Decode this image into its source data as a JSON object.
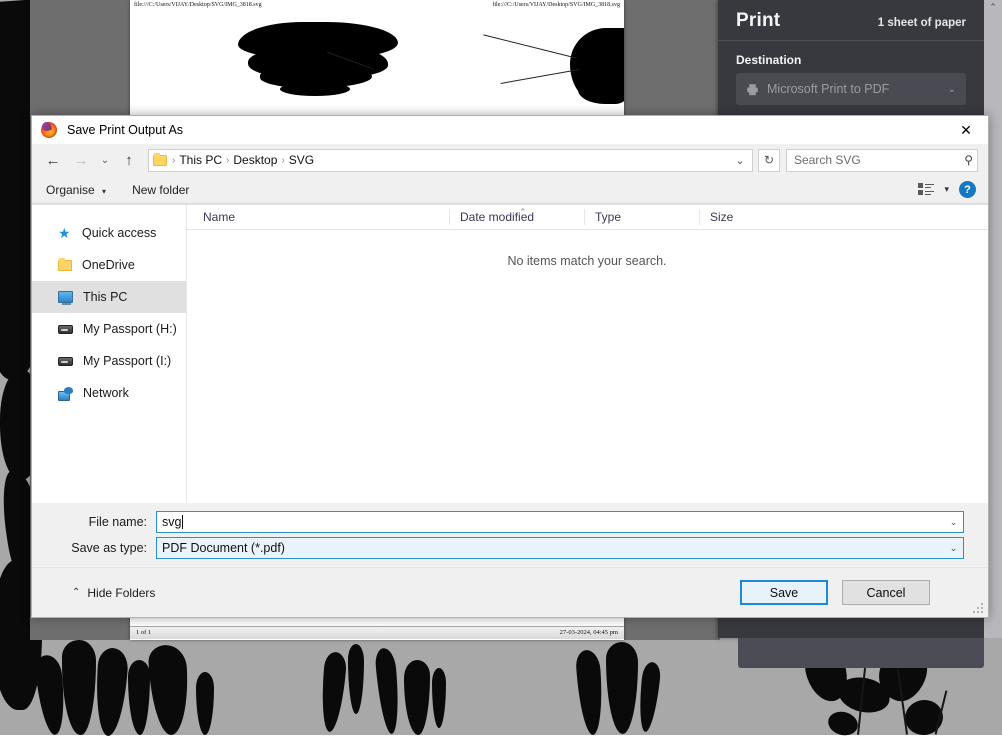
{
  "print_panel": {
    "title": "Print",
    "sheets": "1 sheet of paper",
    "destination_label": "Destination",
    "destination_value": "Microsoft Print to PDF",
    "printer_icon": "printer-icon",
    "chevron_icon": "chevron-down-icon",
    "accent_color": "#1c8098",
    "background_color": "#38393f"
  },
  "preview": {
    "header_left": "file:///C:/Users/VIJAY/Desktop/SVG/IMG_3818.svg",
    "header_right": "file:///C:/Users/VIJAY/Desktop/SVG/IMG_3818.svg",
    "footer_left": "1 of 1",
    "footer_right": "27-03-2024, 04:45 pm"
  },
  "dialog": {
    "title": "Save Print Output As",
    "app_icon": "firefox-icon",
    "close_icon": "close-icon",
    "nav": {
      "back_icon": "arrow-left-icon",
      "forward_icon": "arrow-right-icon",
      "recent_icon": "chevron-down-icon",
      "up_icon": "arrow-up-icon",
      "folder_icon": "folder-icon",
      "breadcrumbs": [
        "This PC",
        "Desktop",
        "SVG"
      ],
      "separator": "›",
      "address_dropdown_icon": "chevron-down-icon",
      "refresh_icon": "refresh-icon"
    },
    "search": {
      "placeholder": "Search SVG",
      "value": "",
      "icon": "search-icon"
    },
    "command_bar": {
      "organise": "Organise",
      "organise_caret": "▾",
      "new_folder": "New folder",
      "view_icon": "view-layout-icon",
      "view_caret": "▾",
      "help_label": "?",
      "help_icon": "help-icon"
    },
    "sidebar": {
      "items": [
        {
          "label": "Quick access",
          "icon": "star-icon",
          "selected": false
        },
        {
          "label": "OneDrive",
          "icon": "folder-icon",
          "selected": false
        },
        {
          "label": "This PC",
          "icon": "computer-icon",
          "selected": true
        },
        {
          "label": "My Passport (H:)",
          "icon": "drive-icon",
          "selected": false
        },
        {
          "label": "My Passport (I:)",
          "icon": "drive-icon",
          "selected": false
        },
        {
          "label": "Network",
          "icon": "network-icon",
          "selected": false
        }
      ]
    },
    "file_list": {
      "columns": [
        "Name",
        "Date modified",
        "Type",
        "Size"
      ],
      "sort_indicator": "⌃",
      "rows": [],
      "empty_message": "No items match your search."
    },
    "form": {
      "file_name_label": "File name:",
      "file_name_value": "svg",
      "file_name_dropdown_icon": "chevron-down-icon",
      "save_as_type_label": "Save as type:",
      "save_as_type_value": "PDF Document (*.pdf)",
      "save_as_type_dropdown_icon": "chevron-down-icon"
    },
    "footer": {
      "hide_folders": "Hide Folders",
      "hide_folders_icon": "chevron-up-icon",
      "save_button": "Save",
      "cancel_button": "Cancel",
      "default_button_color": "#1c8ad8"
    }
  }
}
